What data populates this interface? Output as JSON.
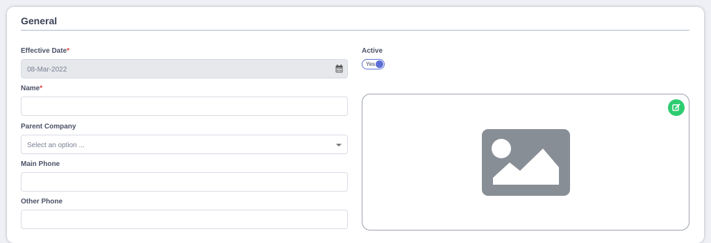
{
  "section": {
    "title": "General"
  },
  "fields": {
    "effective_date": {
      "label": "Effective Date",
      "required_mark": "*",
      "value": "08-Mar-2022",
      "icon": "calendar-icon"
    },
    "name": {
      "label": "Name",
      "required_mark": "*",
      "value": ""
    },
    "parent_company": {
      "label": "Parent Company",
      "placeholder": "Select an option ..."
    },
    "main_phone": {
      "label": "Main Phone",
      "value": ""
    },
    "other_phone": {
      "label": "Other Phone",
      "value": ""
    }
  },
  "active": {
    "label": "Active",
    "toggle_text": "Yes",
    "on": true
  },
  "image": {
    "placeholder_icon": "image-placeholder-icon",
    "edit_icon": "edit-icon"
  },
  "colors": {
    "accent": "#5b6fd6",
    "edit_button": "#2ecc71",
    "required": "#e3342f"
  }
}
